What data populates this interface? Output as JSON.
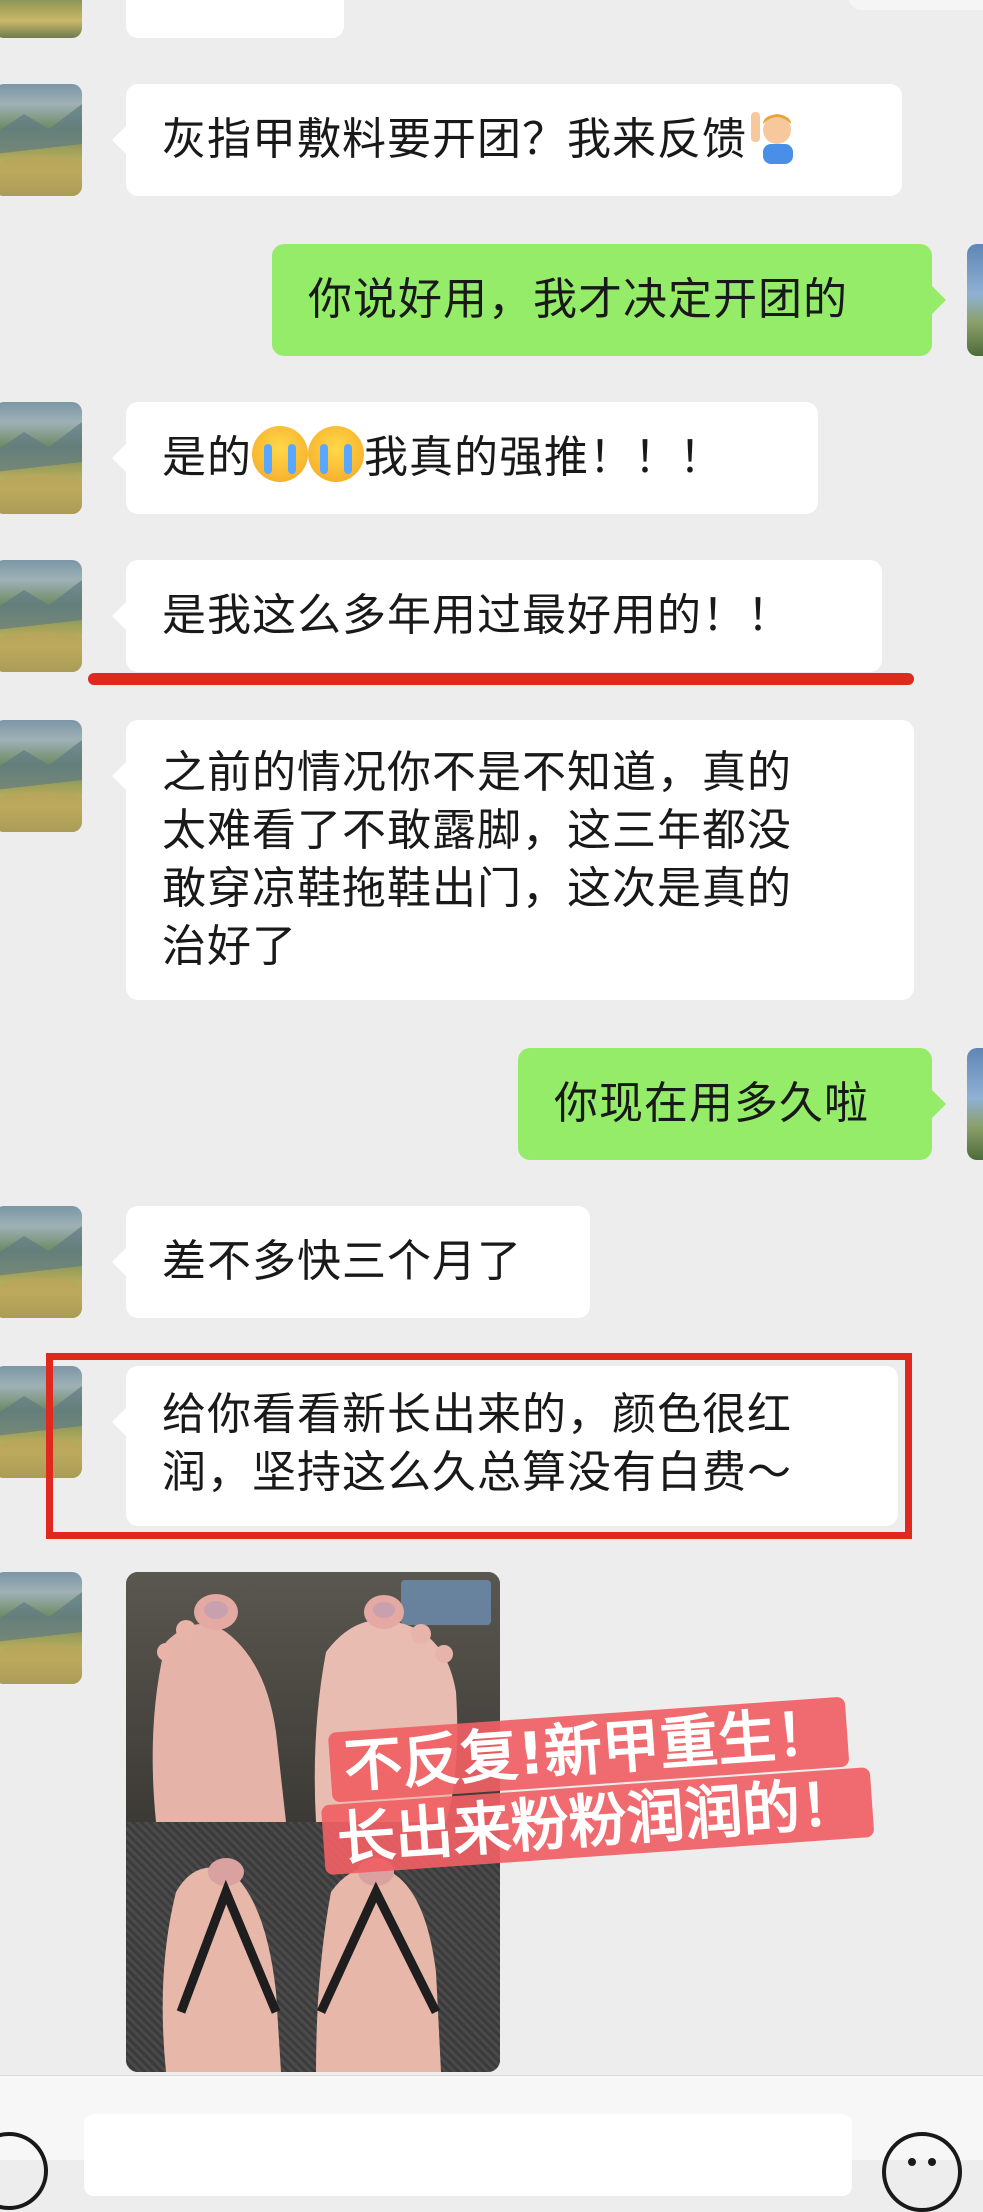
{
  "messages": [
    {
      "id": "m1",
      "side": "in",
      "text": "灰指甲敷料要开团？我来反馈",
      "emoji": "person-raising-hand"
    },
    {
      "id": "m2",
      "side": "out",
      "text": "你说好用，我才决定开团的"
    },
    {
      "id": "m3",
      "side": "in",
      "prefix": "是的",
      "emoji": "loudly-crying-face",
      "suffix": "我真的强推！！！"
    },
    {
      "id": "m4",
      "side": "in",
      "text": "是我这么多年用过最好用的！！",
      "annotation": "red-underline"
    },
    {
      "id": "m5",
      "side": "in",
      "text": "之前的情况你不是不知道，真的\n太难看了不敢露脚，这三年都没\n敢穿凉鞋拖鞋出门，这次是真的\n治好了"
    },
    {
      "id": "m6",
      "side": "out",
      "text": "你现在用多久啦"
    },
    {
      "id": "m7",
      "side": "in",
      "text": "差不多快三个月了"
    },
    {
      "id": "m8",
      "side": "in",
      "text": "给你看看新长出来的，颜色很红\n润，坚持这么久总算没有白费～",
      "annotation": "red-box"
    }
  ],
  "photo": {
    "overlay_line1": "不反复!新甲重生！",
    "overlay_line2": "长出来粉粉润润的！"
  },
  "input_bar": {
    "left_icon": "voice-icon",
    "right_icon": "emoji-icon",
    "text": ""
  },
  "colors": {
    "background": "#ededed",
    "incoming_bubble": "#ffffff",
    "outgoing_bubble": "#95ec69",
    "annotation_red": "#e0281e",
    "overlay_pink": "#f05f64"
  }
}
